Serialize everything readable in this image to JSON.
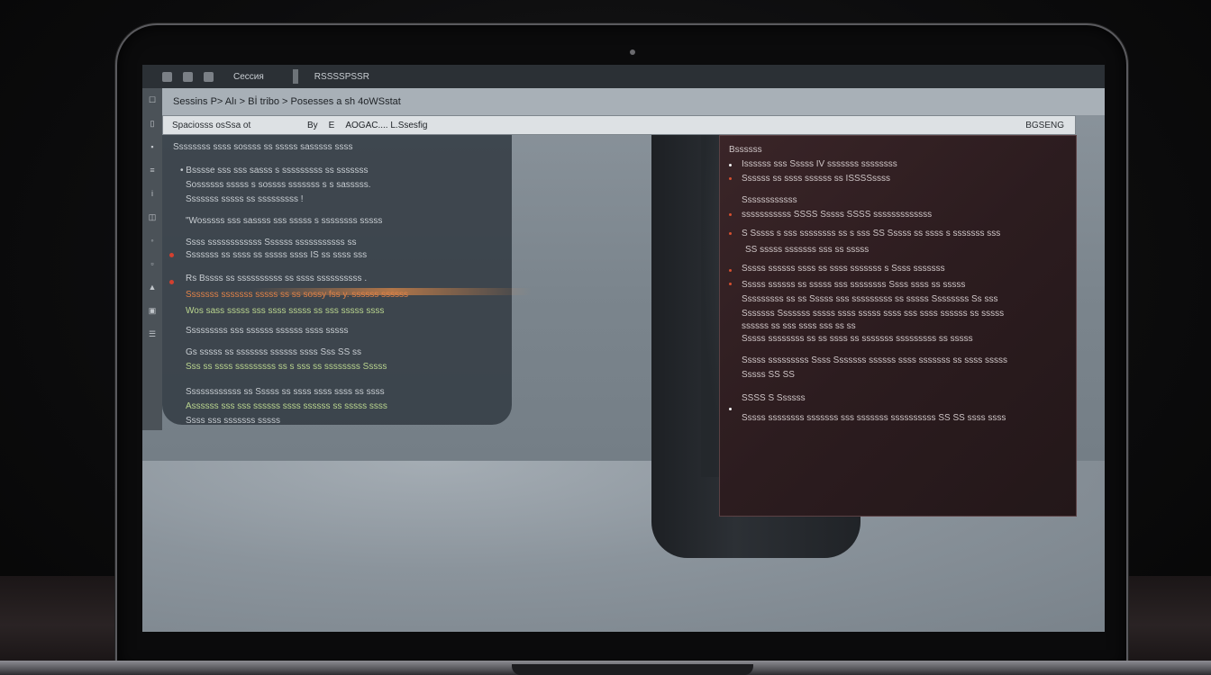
{
  "screen": {
    "menu_bar": {
      "title": "Сессия",
      "title_2": "RSSSSPSSR"
    },
    "breadcrumb": "Sessins P> Alı > Bİ tribo > Posesses a sh 4oWSstat",
    "toolbar": {
      "field": "Spaciosss osSsa ot",
      "pill_1": "By",
      "pill_2": "E",
      "pill_3": "AOGAC.... L.Ssesfig",
      "right_label": "BGSENG"
    },
    "left_panel": {
      "header": "Ssssssss ssss sossss ss sssss sasssss ssss",
      "lines": [
        "• Bsssse sss sss sasss s sssssssss ss sssssss",
        "Sossssss sssss s sossss sssssss s s sasssss.",
        "Sssssss sssss ss sssssssss !",
        "\"Wosssss sss sassss sss sssss s ssssssss sssss",
        "Ssss ssssssssssss Ssssss sssssssssss ss",
        "Sssssss ss ssss ss sssss ssss IS ss ssss sss",
        "Rs Bssss ss ssssssssss ss ssss ssssssssss .",
        "Sssssss sssssss sssss ss ss sossy fss y. ssssss ssssss",
        "Wos sass sssss sss ssss sssss ss sss sssss ssss",
        "Sssssssss sss ssssss ssssss ssss sssss",
        "Gs sssss ss sssssss ssssss ssss Sss SS ss",
        "Sss ss ssss sssssssss ss s sss ss ssssssss Sssss",
        "Ssssssssssss ss Sssss ss ssss ssss ssss ss ssss",
        "Assssss sss sss ssssss ssss ssssss ss sssss ssss",
        "Ssss sss sssssss sssss"
      ]
    },
    "right_panel": {
      "header": "Bssssss",
      "items": [
        "Issssss sss Sssss IV sssssss ssssssss",
        "Ssssss ss ssss ssssss ss  ISSSSssss",
        "Ssssssssssss",
        "sssssssssss SSSS Sssss SSSS sssssssssssss",
        "S Sssss s sss ssssssss ss s sss SS Sssss ss ssss s sssssss sss",
        "SS sssss sssssss sss ss sssss",
        "Sssss ssssss ssss ss ssss sssssss s Ssss sssssss",
        "Sssss ssssss ss sssss sss ssssssss Ssss ssss ss sssss",
        "Sssssssss ss ss Sssss sss sssssssss ss sssss Ssssssss Ss sss",
        "Sssssss Sssssss sssss ssss sssss ssss sss ssss ssssss ss sssss",
        "ssssss ss sss ssss sss ss ss",
        "Sssss ssssssss ss ss ssss ss sssssss sssssssss ss sssss",
        "Sssss sssssssss Ssss Sssssss ssssss ssss sssssss ss ssss sssss",
        "Sssss SS SS",
        "SSSS S Ssssss",
        "Sssss ssssssss sssssss sss sssssss ssssssssss SS SS ssss ssss"
      ]
    }
  }
}
